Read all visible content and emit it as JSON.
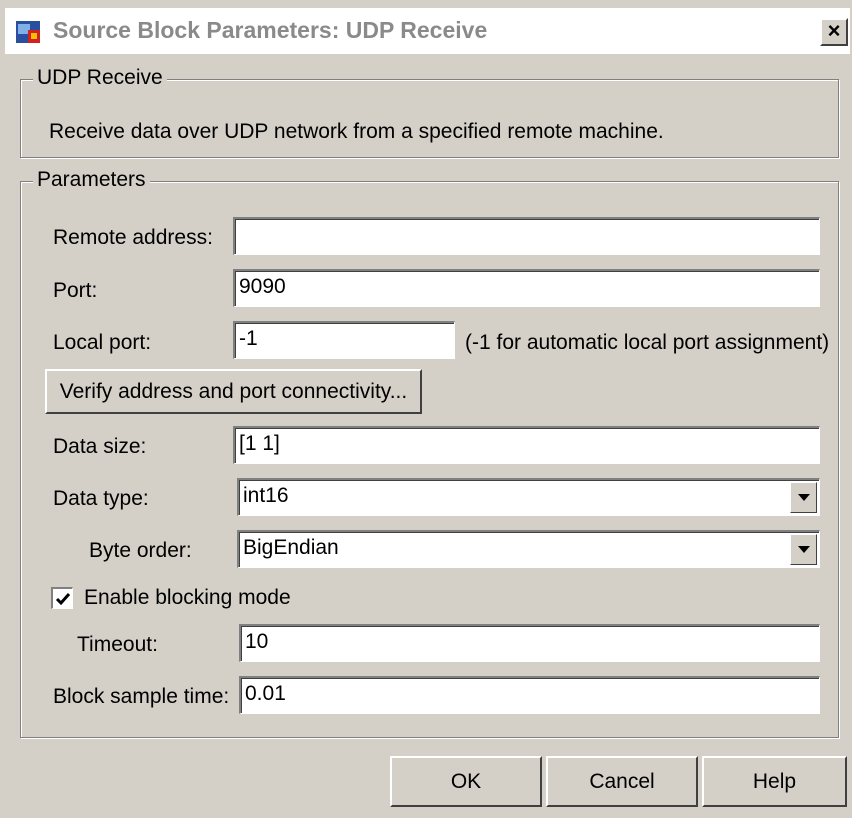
{
  "window": {
    "title": "Source Block Parameters: UDP Receive",
    "close_glyph": "×"
  },
  "description_group": {
    "legend": "UDP Receive",
    "text": "Receive data over UDP network from a specified remote machine."
  },
  "parameters": {
    "legend": "Parameters",
    "remote_address": {
      "label": "Remote address:",
      "value": ""
    },
    "port": {
      "label": "Port:",
      "value": "9090"
    },
    "local_port": {
      "label": "Local port:",
      "value": "-1",
      "hint": "(-1 for automatic local port assignment)"
    },
    "verify_button": "Verify address and port connectivity...",
    "data_size": {
      "label": "Data size:",
      "value": "[1 1]"
    },
    "data_type": {
      "label": "Data type:",
      "value": "int16"
    },
    "byte_order": {
      "label": "Byte order:",
      "value": "BigEndian"
    },
    "blocking": {
      "label": "Enable blocking mode",
      "checked": true
    },
    "timeout": {
      "label": "Timeout:",
      "value": "10"
    },
    "sample_time": {
      "label": "Block sample time:",
      "value": "0.01"
    }
  },
  "buttons": {
    "ok": "OK",
    "cancel": "Cancel",
    "help": "Help"
  },
  "icons": {
    "title": "simulink-block-icon",
    "close": "close-icon",
    "dropdown": "chevron-down-icon",
    "check": "checkmark-icon"
  }
}
